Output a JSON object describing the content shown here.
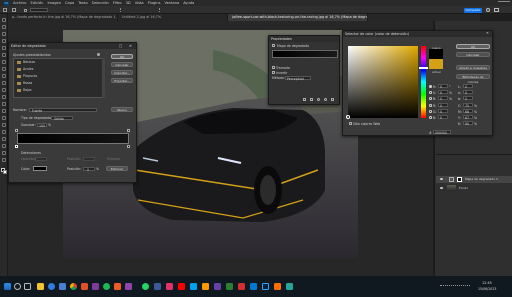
{
  "app": {
    "logo": "Ps"
  },
  "menu": [
    "Archivo",
    "Edición",
    "Imagen",
    "Capa",
    "Texto",
    "Selección",
    "Filtro",
    "3D",
    "Vista",
    "Plugins",
    "Ventana",
    "Ayuda"
  ],
  "tabs": [
    {
      "label": "p...fondo perfecto In line.jpg al 16,7% (Mapa de degradado 1, Máscara de capa/8)",
      "active": false
    },
    {
      "label": "Untitled-2.jpg al 16,7%",
      "active": false
    },
    {
      "label": "jaillee-sport-car-with-black-texturing-on-the-racing.jpg al 16,7% (Mapa de degradado 1, Máscara de capa/8) *",
      "active": true
    }
  ],
  "share_label": "Compartir",
  "gradient_editor": {
    "title": "Editor de degradado",
    "presets_label": "Ajustes preestablecidos",
    "folders": [
      "Básicos",
      "Azules",
      "Púrpuras",
      "Rosas",
      "Rojos"
    ],
    "ok": "OK",
    "cancel": "Cancelar",
    "import": "Importar...",
    "export": "Exportar...",
    "name_label": "Nombre:",
    "name_value": "Fuerte",
    "new_label": "Nuevo",
    "type_label": "Tipo de degradado:",
    "type_value": "Sólido",
    "smooth_label": "Suavizar:",
    "smooth_value": "100",
    "smooth_unit": "%",
    "stops_label": "Detenciones",
    "opacity_label": "Opacidad:",
    "location_label": "Posición:",
    "delete_label": "Eliminar",
    "color_label": "Color:",
    "location2_label": "Posición:",
    "location2_value": "0",
    "location2_unit": "%",
    "delete2_label": "Eliminar"
  },
  "properties": {
    "title": "Propiedades",
    "subtitle": "Mapa de degradado",
    "dither": "Tramado",
    "reverse": "Invertir",
    "method_label": "Método:",
    "method_value": "Perceptual"
  },
  "color_picker": {
    "title": "Selector de color (color de detención)",
    "new_label": "nuevo",
    "current_label": "actual",
    "ok": "OK",
    "cancel": "Cancelar",
    "add_to_swatches": "Añadir a muestras",
    "color_libraries": "Bibliotecas de colores",
    "web_only": "Sólo colores Web",
    "fields": [
      {
        "label": "H:",
        "value": "0",
        "unit": "°"
      },
      {
        "label": "S:",
        "value": "0",
        "unit": "%"
      },
      {
        "label": "B:",
        "value": "0",
        "unit": "%"
      },
      {
        "label": "R:",
        "value": "0",
        "unit": ""
      },
      {
        "label": "G:",
        "value": "0",
        "unit": ""
      },
      {
        "label": "B:",
        "value": "0",
        "unit": ""
      }
    ],
    "lab_fields": [
      {
        "label": "L:",
        "value": "0"
      },
      {
        "label": "a:",
        "value": "0"
      },
      {
        "label": "b:",
        "value": "0"
      },
      {
        "label": "C:",
        "value": "75",
        "unit": "%"
      },
      {
        "label": "M:",
        "value": "68",
        "unit": "%"
      },
      {
        "label": "Y:",
        "value": "67",
        "unit": "%"
      },
      {
        "label": "K:",
        "value": "90",
        "unit": "%"
      }
    ],
    "hex_label": "#",
    "hex_value": "000000"
  },
  "layers": [
    {
      "name": "Mapa de degradado 1"
    },
    {
      "name": "Fondo"
    }
  ],
  "taskbar": {
    "time": "12:45",
    "date": "15/06/2023"
  },
  "colors": {
    "accent": "#1473e6",
    "panel": "#2f2f2f",
    "dialog": "#3a3a3a",
    "gold": "#d4a017"
  }
}
